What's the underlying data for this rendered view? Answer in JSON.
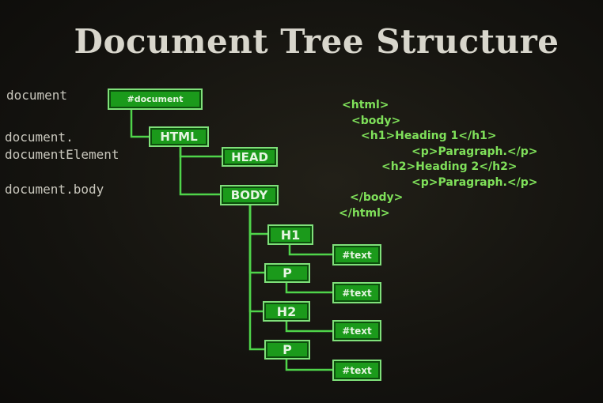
{
  "title": "Document Tree Structure",
  "labels": {
    "document": "document",
    "document_element_1": "document.",
    "document_element_2": "documentElement",
    "document_body": "document.body"
  },
  "nodes": {
    "document": "#document",
    "html": "HTML",
    "head": "HEAD",
    "body": "BODY",
    "h1": "H1",
    "p1": "P",
    "h2": "H2",
    "p2": "P",
    "text1": "#text",
    "text2": "#text",
    "text3": "#text",
    "text4": "#text"
  },
  "markup_lines": [
    "<html>",
    "<body>",
    "<h1>Heading 1</h1>",
    "<p>Paragraph.</p>",
    "<h2>Heading 2</h2>",
    "<p>Paragraph.</p>",
    "</body>",
    "</html>"
  ],
  "colors": {
    "background": "#14130f",
    "node_fill": "#1b9a1b",
    "node_border": "#7fe07a",
    "connector": "#4fd44a",
    "markup_text": "#7fe05a",
    "label_text": "#c9c7bd",
    "title_text": "#d8d6cc"
  }
}
